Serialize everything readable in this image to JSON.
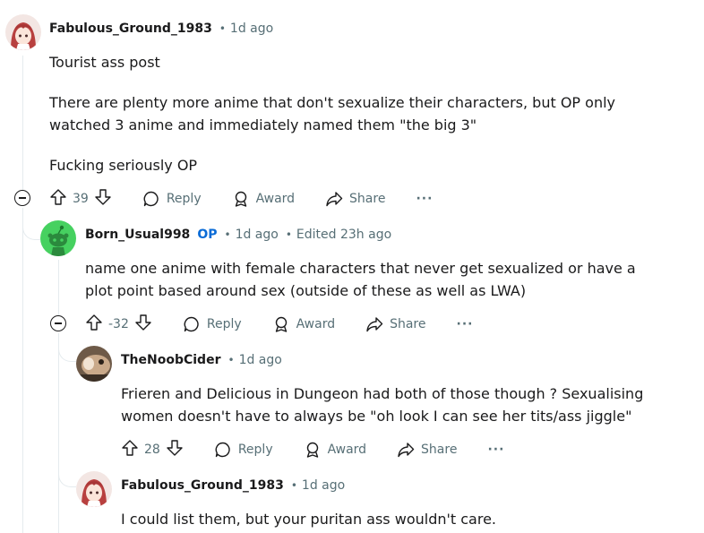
{
  "comments": [
    {
      "author": "Fabulous_Ground_1983",
      "time": "1d ago",
      "body": [
        "Tourist ass post",
        "There are plenty more anime that don't sexualize their characters, but OP only watched 3 anime and immediately named them \"the big 3\"",
        "Fucking seriously OP"
      ],
      "score": "39",
      "reply_label": "Reply",
      "award_label": "Award",
      "share_label": "Share",
      "more_label": "···"
    },
    {
      "author": "Born_Usual998",
      "op_badge": "OP",
      "time": "1d ago",
      "edited": "Edited 23h ago",
      "body": [
        "name one anime with female characters that never get sexualized or have a plot point based around sex (outside of these as well as LWA)"
      ],
      "score": "-32",
      "reply_label": "Reply",
      "award_label": "Award",
      "share_label": "Share",
      "more_label": "···"
    },
    {
      "author": "TheNoobCider",
      "time": "1d ago",
      "body": [
        "Frieren and Delicious in Dungeon had both of those though ? Sexualising women doesn't have to always be \"oh look I can see her tits/ass jiggle\""
      ],
      "score": "28",
      "reply_label": "Reply",
      "award_label": "Award",
      "share_label": "Share",
      "more_label": "···"
    },
    {
      "author": "Fabulous_Ground_1983",
      "time": "1d ago",
      "body": [
        "I could list them, but your puritan ass wouldn't care."
      ]
    }
  ],
  "separator": "•",
  "colors": {
    "text": "#1a1a1b",
    "meta": "#576f76",
    "op": "#0a6bd6",
    "thread": "#e5ebee"
  },
  "icons": [
    "upvote-icon",
    "downvote-icon",
    "reply-bubble-icon",
    "award-icon",
    "share-icon",
    "collapse-icon",
    "snoo-avatar-icon"
  ]
}
